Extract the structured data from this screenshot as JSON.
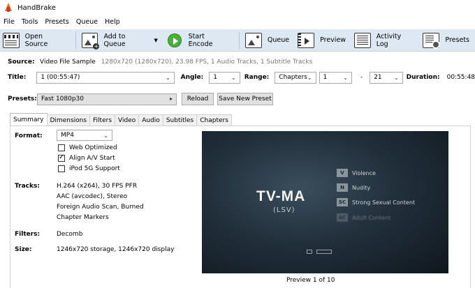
{
  "app": {
    "title": "HandBrake"
  },
  "menu": [
    "File",
    "Tools",
    "Presets",
    "Queue",
    "Help"
  ],
  "toolbar": {
    "open_source": "Open Source",
    "add_to_queue": "Add to Queue",
    "start_encode": "Start Encode",
    "queue": "Queue",
    "preview": "Preview",
    "activity_log": "Activity Log",
    "presets": "Presets"
  },
  "source": {
    "label": "Source:",
    "name": "Video File Sample",
    "details": "1280x720 (1280x720), 23.98 FPS, 1 Audio Tracks, 1 Subtitle Tracks"
  },
  "title_row": {
    "title_label": "Title:",
    "title_value": "1 (00:55:47)",
    "angle_label": "Angle:",
    "angle_value": "1",
    "range_label": "Range:",
    "range_type": "Chapters",
    "range_start": "1",
    "range_dash": "-",
    "range_end": "21",
    "duration_label": "Duration:",
    "duration_value": "00:55:48"
  },
  "presets_row": {
    "label": "Presets:",
    "value": "Fast 1080p30",
    "reload": "Reload",
    "save_new": "Save New Preset"
  },
  "tabs": [
    "Summary",
    "Dimensions",
    "Filters",
    "Video",
    "Audio",
    "Subtitles",
    "Chapters"
  ],
  "summary": {
    "format_label": "Format:",
    "format_value": "MP4",
    "web_optimized": "Web Optimized",
    "align_av": "Align A/V Start",
    "ipod": "iPod 5G Support",
    "tracks_label": "Tracks:",
    "tracks": [
      "H.264 (x264), 30 FPS PFR",
      "AAC (avcodec), Stereo",
      "Foreign Audio Scan, Burned",
      "Chapter Markers"
    ],
    "filters_label": "Filters:",
    "filters_value": "Decomb",
    "size_label": "Size:",
    "size_value": "1246x720 storage, 1246x720 display"
  },
  "checkboxes": {
    "web_optimized": false,
    "align_av": true,
    "ipod": false
  },
  "preview": {
    "rating": "TV-MA",
    "sub": "(LSV)",
    "items": [
      {
        "code": "V",
        "text": "Violence"
      },
      {
        "code": "N",
        "text": "Nudity"
      },
      {
        "code": "SC",
        "text": "Strong Sexual Content"
      },
      {
        "code": "AC",
        "text": "Adult Content"
      }
    ],
    "caption": "Preview 1 of 10"
  },
  "colors": {
    "toolbar_bg": "#dde8f3",
    "play_green": "#4caf3a"
  }
}
